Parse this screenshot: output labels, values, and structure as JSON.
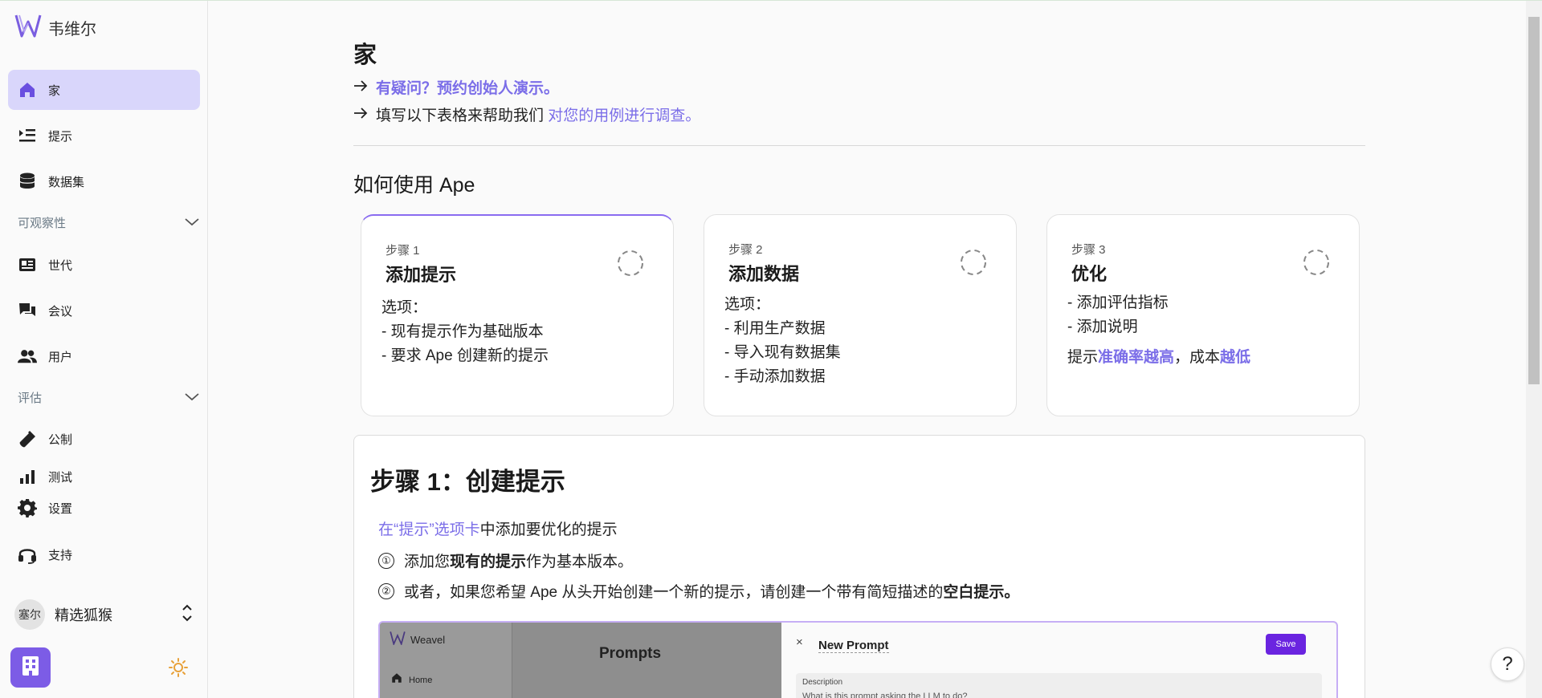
{
  "sidebar": {
    "brand": "韦维尔",
    "nav_home": "家",
    "nav_prompts": "提示",
    "nav_datasets": "数据集",
    "section_observability": "可观察性",
    "nav_generations": "世代",
    "nav_sessions": "会议",
    "nav_users": "用户",
    "section_evaluation": "评估",
    "nav_metrics": "公制",
    "nav_tests": "测试",
    "nav_settings": "设置",
    "nav_support": "支持",
    "user_avatar": "塞尔",
    "user_name": "精选狐猴"
  },
  "main": {
    "title": "家",
    "link1": "有疑问？预约创始人演示。",
    "link2_prefix": "填写以下表格来帮助我们 ",
    "link2_link": "对您的用例进行调查。",
    "how_to": "如何使用 Ape",
    "cards": [
      {
        "step": "步骤 1",
        "title": "添加提示",
        "options": "选项：",
        "lines": [
          "- 现有提示作为基础版本",
          "- 要求 Ape 创建新的提示"
        ]
      },
      {
        "step": "步骤 2",
        "title": "添加数据",
        "options": "选项：",
        "lines": [
          "- 利用生产数据",
          "- 导入现有数据集",
          "- 手动添加数据"
        ]
      },
      {
        "step": "步骤 3",
        "title": "优化",
        "lines": [
          "- 添加评估指标",
          "- 添加说明"
        ],
        "tag_prefix": "提示",
        "tag_a": "准确率越高",
        "tag_mid": "，成本",
        "tag_b": "越低"
      }
    ],
    "step1": {
      "heading": "步骤 1：创建提示",
      "sub_link": "在“提示”选项卡",
      "sub_rest": "中添加要优化的提示",
      "item1_num": "①",
      "item1_a": "添加您",
      "item1_b": "现有的提示",
      "item1_c": "作为基本版本。",
      "item2_num": "②",
      "item2_a": "或者，如果您希望 Ape 从头开始创建一个新的提示，请创建一个带有简短描述的",
      "item2_b": "空白提示。"
    },
    "screenshot": {
      "brand": "Weavel",
      "nav_home": "Home",
      "page_title": "Prompts",
      "close": "×",
      "modal_title": "New Prompt",
      "save": "Save",
      "desc_label": "Description",
      "desc_placeholder": "What is this prompt asking the LLM to do?"
    }
  },
  "help": "?",
  "colors": {
    "accent": "#7b6ee8",
    "active_bg": "#d9d6fb",
    "org": "#7c5ce6"
  }
}
